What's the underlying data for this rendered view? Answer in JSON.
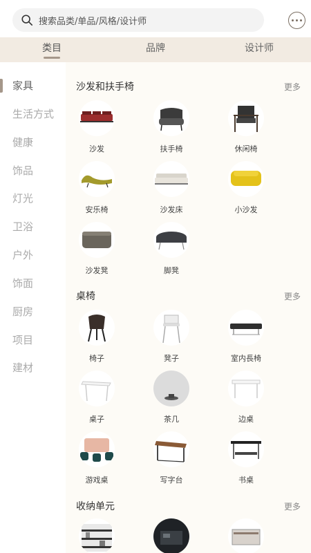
{
  "search": {
    "placeholder": "搜索品类/单品/风格/设计师"
  },
  "icons": {
    "search": "search-icon",
    "message": "message-icon"
  },
  "tabs": [
    {
      "label": "类目",
      "active": true
    },
    {
      "label": "品牌",
      "active": false
    },
    {
      "label": "设计师",
      "active": false
    }
  ],
  "sidebar": {
    "items": [
      {
        "label": "家具",
        "active": true
      },
      {
        "label": "生活方式"
      },
      {
        "label": "健康"
      },
      {
        "label": "饰品"
      },
      {
        "label": "灯光"
      },
      {
        "label": "卫浴"
      },
      {
        "label": "户外"
      },
      {
        "label": "饰面"
      },
      {
        "label": "厨房"
      },
      {
        "label": "项目"
      },
      {
        "label": "建材"
      }
    ]
  },
  "sections": [
    {
      "title": "沙发和扶手椅",
      "more": "更多",
      "items": [
        {
          "label": "沙发",
          "icon": "sofa-icon"
        },
        {
          "label": "扶手椅",
          "icon": "armchair-icon"
        },
        {
          "label": "休闲椅",
          "icon": "lounge-chair-icon"
        },
        {
          "label": "安乐椅",
          "icon": "chaise-icon"
        },
        {
          "label": "沙发床",
          "icon": "sofa-bed-icon"
        },
        {
          "label": "小沙发",
          "icon": "small-sofa-icon"
        },
        {
          "label": "沙发凳",
          "icon": "sofa-stool-icon"
        },
        {
          "label": "脚凳",
          "icon": "footstool-icon"
        }
      ]
    },
    {
      "title": "桌椅",
      "more": "更多",
      "items": [
        {
          "label": "椅子",
          "icon": "chair-icon"
        },
        {
          "label": "凳子",
          "icon": "stool-icon"
        },
        {
          "label": "室内長椅",
          "icon": "bench-icon"
        },
        {
          "label": "桌子",
          "icon": "table-icon"
        },
        {
          "label": "茶几",
          "icon": "coffee-table-icon"
        },
        {
          "label": "边桌",
          "icon": "side-table-icon"
        },
        {
          "label": "游戏桌",
          "icon": "game-table-icon"
        },
        {
          "label": "写字台",
          "icon": "desk-icon"
        },
        {
          "label": "书桌",
          "icon": "writing-desk-icon"
        }
      ]
    },
    {
      "title": "收纳单元",
      "more": "更多",
      "items": [
        {
          "label": "",
          "icon": "shelf-icon"
        },
        {
          "label": "",
          "icon": "cabinet-icon"
        },
        {
          "label": "",
          "icon": "sideboard-icon"
        }
      ]
    }
  ]
}
